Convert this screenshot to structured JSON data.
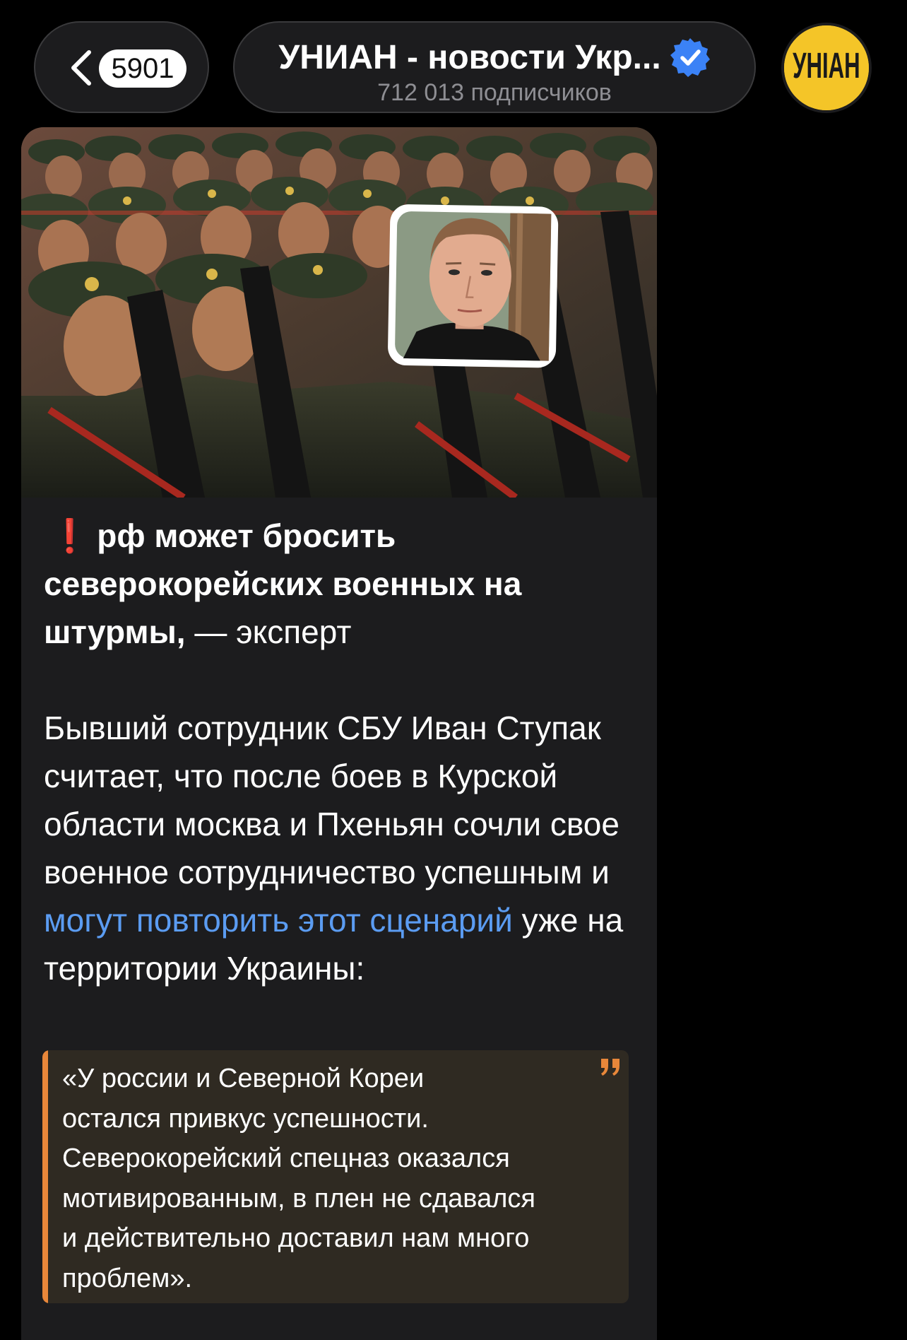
{
  "header": {
    "unread_count": "5901",
    "channel_title": "УНИАН - новости Укр...",
    "subscribers": "712 013 подписчиков",
    "avatar_text": "УНІАН"
  },
  "post": {
    "headline_emoji": "❗",
    "headline_bold": "рф может бросить северокорейских военных на штурмы,",
    "headline_rest": " — эксперт",
    "body_before_link": "Бывший сотрудник СБУ Иван Ступак считает, что после боев в Курской области москва и Пхеньян сочли свое военное сотрудничество успешным и ",
    "link_text": "могут повторить этот сценарий",
    "body_after_link": " уже на территории Украины:",
    "quote": "«У россии и Северной Кореи\nостался привкус успешности.\nСеверокорейский спецназ оказался\nмотивированным, в плен не сдавался\nи действительно доставил нам много\nпроблем»."
  },
  "colors": {
    "background": "#000000",
    "bubble": "#1c1c1e",
    "link": "#5b9cf2",
    "quote_bar": "#e8873a",
    "quote_bg": "#2f2a22",
    "avatar_bg": "#f4c528",
    "verified": "#3b82f6"
  },
  "icons": {
    "back": "chevron-left-icon",
    "verified": "verified-badge-icon",
    "quote": "quote-icon",
    "exclamation": "red-exclamation-icon"
  }
}
